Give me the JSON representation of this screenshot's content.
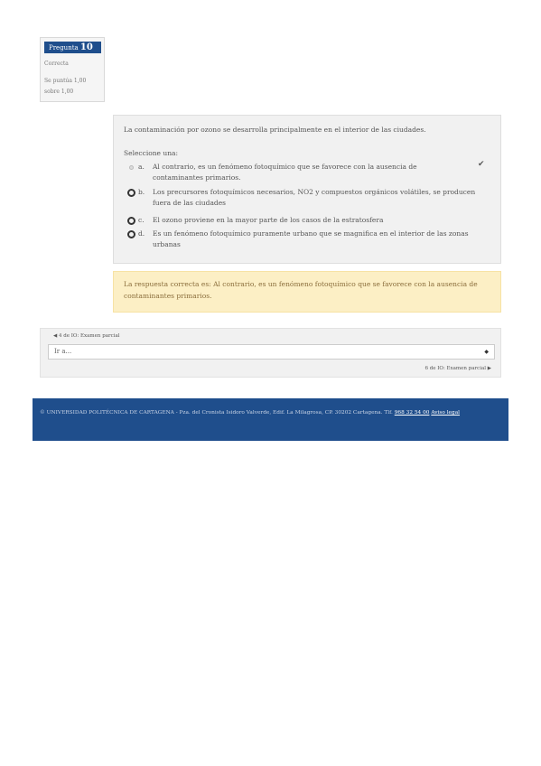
{
  "question_info": {
    "label": "Pregunta",
    "number": "10",
    "status": "Correcta",
    "score_line1": "Se puntúa 1,00",
    "score_line2": "sobre 1,00"
  },
  "question": {
    "text": "La contaminación por ozono se desarrolla principalmente en el interior de las ciudades.",
    "select_label": "Seleccione una:",
    "answers": [
      {
        "letter": "a.",
        "text": "Al contrario, es un fenómeno fotoquímico que se favorece con la ausencia de contaminantes primarios.",
        "selected": true
      },
      {
        "letter": "b.",
        "text": "Los precursores fotoquímicos necesarios, NO2 y compuestos orgánicos volátiles, se producen fuera de las ciudades",
        "selected": false
      },
      {
        "letter": "c.",
        "text": "El ozono proviene en la mayor parte de los casos de la estratosfera",
        "selected": false
      },
      {
        "letter": "d.",
        "text": "Es un fenómeno fotoquímico puramente urbano que se magnifica en el interior de las zonas urbanas",
        "selected": false
      }
    ],
    "correct_icon": "check-icon"
  },
  "feedback": {
    "text": "La respuesta correcta es: Al contrario, es un fenómeno fotoquímico que se favorece con la ausencia de contaminantes primarios."
  },
  "navigation": {
    "prev_label": "4 de IO: Examen parcial",
    "jump_placeholder": "Ir a...",
    "next_label": "6 de IO: Examen parcial"
  },
  "footer": {
    "text": "© UNIVERSIDAD POLITÉCNICA DE CARTAGENA - Pza. del Cronista Isidoro Valverde, Edif. La Milagrosa, CP. 30202 Cartagena. Tlf.",
    "phone": "968 32 54 00",
    "legal_link": "Aviso legal"
  },
  "colors": {
    "brand_blue": "#1f4e8c",
    "feedback_bg": "#fcefc5",
    "feedback_text": "#8a6d3b"
  }
}
